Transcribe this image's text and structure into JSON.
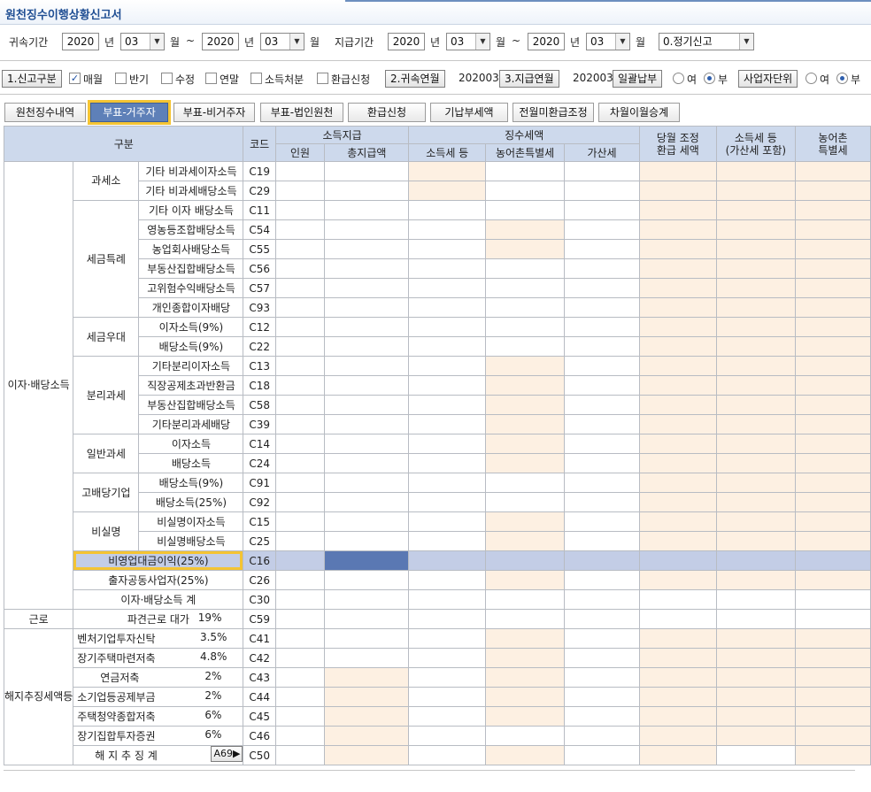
{
  "title": "원천징수이행상황신고서",
  "filters": {
    "attr_period_label": "귀속기간",
    "pay_period_label": "지급기간",
    "year_unit": "년",
    "month_unit": "월",
    "tilde": "~",
    "attr_from_year": "2020",
    "attr_from_month": "03",
    "attr_to_year": "2020",
    "attr_to_month": "03",
    "pay_from_year": "2020",
    "pay_from_month": "03",
    "pay_to_year": "2020",
    "pay_to_month": "03",
    "report_type": "0.정기신고"
  },
  "options": {
    "report_kind_btn": "1.신고구분",
    "monthly": "매월",
    "half": "반기",
    "amend": "수정",
    "yearend": "연말",
    "income_disposal": "소득처분",
    "refund_apply": "환급신청",
    "attr_ym_btn": "2.귀속연월",
    "attr_ym": "202003",
    "pay_ym_btn": "3.지급연월",
    "pay_ym": "202003",
    "lump_btn": "일괄납부",
    "yes": "여",
    "no": "부",
    "biz_unit_btn": "사업자단위"
  },
  "tabs": [
    "원천징수내역",
    "부표-거주자",
    "부표-비거주자",
    "부표-법인원천",
    "환급신청",
    "기납부세액",
    "전월미환급조정",
    "차월이월승계"
  ],
  "table": {
    "headers": {
      "category": "구분",
      "code": "코드",
      "income_payment": "소득지급",
      "persons": "인원",
      "total_pay": "총지급액",
      "withheld_tax": "징수세액",
      "income_tax": "소득세 등",
      "rural_tax": "농어촌특별세",
      "penalty_tax": "가산세",
      "adj_refund_1": "당월 조정",
      "adj_refund_2": "환급 세액",
      "paid_tax_1": "소득세 등",
      "paid_tax_2": "(가산세 포함)",
      "rural_paid_1": "농어촌",
      "rural_paid_2": "특별세"
    },
    "groups": {
      "interest_dividend": "이자·배당소득",
      "taxfree": "과세소",
      "special": "세금특례",
      "preferential": "세금우대",
      "separate": "분리과세",
      "general": "일반과세",
      "high_dividend": "고배당기업",
      "nonreal": "비실명",
      "labor": "근로",
      "rescission": "해지추징세액등"
    },
    "rows": [
      {
        "name": "기타 비과세이자소득",
        "code": "C19"
      },
      {
        "name": "기타 비과세배당소득",
        "code": "C29"
      },
      {
        "name": "기타 이자 배당소득",
        "code": "C11"
      },
      {
        "name": "영농등조합배당소득",
        "code": "C54"
      },
      {
        "name": "농업회사배당소득",
        "code": "C55"
      },
      {
        "name": "부동산집합배당소득",
        "code": "C56"
      },
      {
        "name": "고위험수익배당소득",
        "code": "C57"
      },
      {
        "name": "개인종합이자배당",
        "code": "C93"
      },
      {
        "name": "이자소득(9%)",
        "code": "C12"
      },
      {
        "name": "배당소득(9%)",
        "code": "C22"
      },
      {
        "name": "기타분리이자소득",
        "code": "C13"
      },
      {
        "name": "직장공제초과반환금",
        "code": "C18"
      },
      {
        "name": "부동산집합배당소득",
        "code": "C58"
      },
      {
        "name": "기타분리과세배당",
        "code": "C39"
      },
      {
        "name": "이자소득",
        "code": "C14"
      },
      {
        "name": "배당소득",
        "code": "C24"
      },
      {
        "name": "배당소득(9%)",
        "code": "C91"
      },
      {
        "name": "배당소득(25%)",
        "code": "C92"
      },
      {
        "name": "비실명이자소득",
        "code": "C15"
      },
      {
        "name": "비실명배당소득",
        "code": "C25"
      },
      {
        "name": "비영업대금이익(25%)",
        "code": "C16"
      },
      {
        "name": "출자공동사업자(25%)",
        "code": "C26"
      },
      {
        "name": "이자·배당소득 계",
        "code": "C30"
      },
      {
        "name": "파견근로 대가",
        "rate": "19%",
        "code": "C59"
      },
      {
        "name": "벤처기업투자신탁",
        "rate": "3.5%",
        "code": "C41"
      },
      {
        "name": "장기주택마련저축",
        "rate": "4.8%",
        "code": "C42"
      },
      {
        "name": "연금저축",
        "rate": "2%",
        "code": "C43"
      },
      {
        "name": "소기업등공제부금",
        "rate": "2%",
        "code": "C44"
      },
      {
        "name": "주택청약종합저축",
        "rate": "6%",
        "code": "C45"
      },
      {
        "name": "장기집합투자증권",
        "rate": "6%",
        "code": "C46"
      },
      {
        "name": "해 지 추 징 계",
        "code": "C50",
        "button": "A69▶"
      }
    ]
  }
}
